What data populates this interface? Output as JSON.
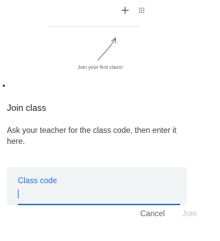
{
  "header": {
    "add_icon": "plus-icon",
    "apps_icon": "apps-grid-icon"
  },
  "empty_state": {
    "arrow_icon": "curved-arrow-icon",
    "hint": "Join your first class!"
  },
  "dialog": {
    "title": "Join class",
    "description": "Ask your teacher for the class code, then enter it here.",
    "code_field": {
      "label": "Class code",
      "value": ""
    },
    "cancel_label": "Cancel",
    "join_label": "Join",
    "accent_color": "#1a73e8",
    "disabled_color": "#bdc1c6"
  }
}
